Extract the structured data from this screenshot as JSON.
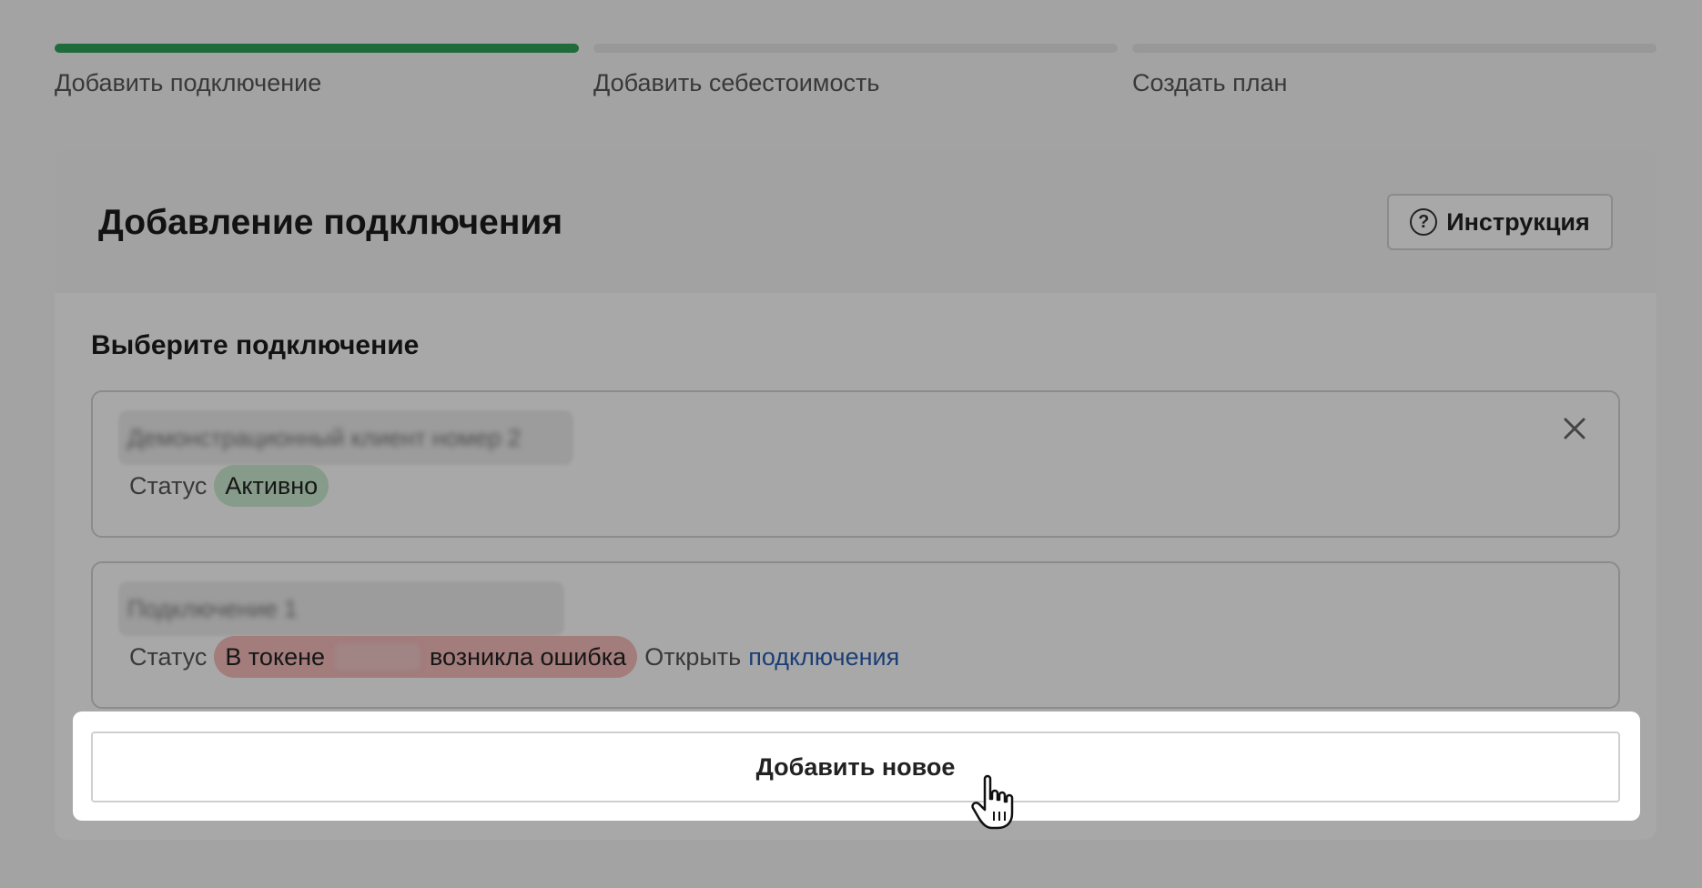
{
  "stepper": {
    "steps": [
      {
        "label": "Добавить подключение",
        "active": true
      },
      {
        "label": "Добавить себестоимость",
        "active": false
      },
      {
        "label": "Создать план",
        "active": false
      }
    ],
    "active_color": "#2fa05a"
  },
  "card": {
    "title": "Добавление подключения",
    "instruction_button": "Инструкция",
    "help_icon": "question-circle-icon"
  },
  "section": {
    "title": "Выберите подключение"
  },
  "connections": [
    {
      "name_blurred": "Демонстрационный клиент номер 2",
      "status_label": "Статус",
      "status_text": "Активно",
      "status_color": "#c8e8cc"
    },
    {
      "name_blurred": "Подключение 1",
      "status_label": "Статус",
      "status_text_before": "В токене",
      "status_text_after": "возникла ошибка",
      "status_color": "#f3b9b9",
      "open_text": "Открыть",
      "open_link": "подключения"
    }
  ],
  "add_button": {
    "label": "Добавить новое"
  },
  "icons": {
    "close": "close-icon",
    "cursor": "hand-pointer-icon"
  }
}
